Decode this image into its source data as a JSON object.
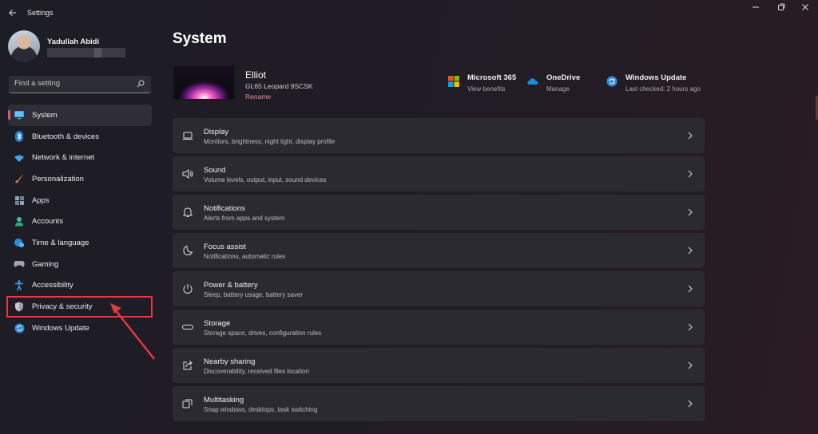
{
  "window": {
    "title": "Settings"
  },
  "user": {
    "name": "Yadullah Abidi"
  },
  "search": {
    "placeholder": "Find a setting"
  },
  "sidebar": {
    "items": [
      {
        "label": "System",
        "icon": "monitor-icon"
      },
      {
        "label": "Bluetooth & devices",
        "icon": "bluetooth-icon"
      },
      {
        "label": "Network & internet",
        "icon": "wifi-icon"
      },
      {
        "label": "Personalization",
        "icon": "brush-icon"
      },
      {
        "label": "Apps",
        "icon": "apps-icon"
      },
      {
        "label": "Accounts",
        "icon": "person-icon"
      },
      {
        "label": "Time & language",
        "icon": "globe-clock-icon"
      },
      {
        "label": "Gaming",
        "icon": "gamepad-icon"
      },
      {
        "label": "Accessibility",
        "icon": "accessibility-icon"
      },
      {
        "label": "Privacy & security",
        "icon": "shield-icon"
      },
      {
        "label": "Windows Update",
        "icon": "update-icon"
      }
    ],
    "active": "System",
    "highlighted": "Privacy & security"
  },
  "page": {
    "title": "System"
  },
  "device": {
    "name": "Elliot",
    "model": "GL65 Leopard 9SCSK",
    "rename": "Rename"
  },
  "quick_links": [
    {
      "title": "Microsoft 365",
      "subtitle": "View benefits",
      "icon": "microsoft-logo-icon"
    },
    {
      "title": "OneDrive",
      "subtitle": "Manage",
      "icon": "onedrive-cloud-icon"
    },
    {
      "title": "Windows Update",
      "subtitle": "Last checked: 2 hours ago",
      "icon": "refresh-icon"
    }
  ],
  "settings": [
    {
      "title": "Display",
      "subtitle": "Monitors, brightness, night light, display profile",
      "icon": "laptop-icon"
    },
    {
      "title": "Sound",
      "subtitle": "Volume levels, output, input, sound devices",
      "icon": "speaker-icon"
    },
    {
      "title": "Notifications",
      "subtitle": "Alerts from apps and system",
      "icon": "bell-icon"
    },
    {
      "title": "Focus assist",
      "subtitle": "Notifications, automatic rules",
      "icon": "moon-icon"
    },
    {
      "title": "Power & battery",
      "subtitle": "Sleep, battery usage, battery saver",
      "icon": "power-icon"
    },
    {
      "title": "Storage",
      "subtitle": "Storage space, drives, configuration rules",
      "icon": "storage-icon"
    },
    {
      "title": "Nearby sharing",
      "subtitle": "Discoverability, received files location",
      "icon": "share-icon"
    },
    {
      "title": "Multitasking",
      "subtitle": "Snap windows, desktops, task switching",
      "icon": "multitask-icon"
    }
  ],
  "colors": {
    "accent": "#d65a70",
    "annotation": "#e5393f"
  }
}
